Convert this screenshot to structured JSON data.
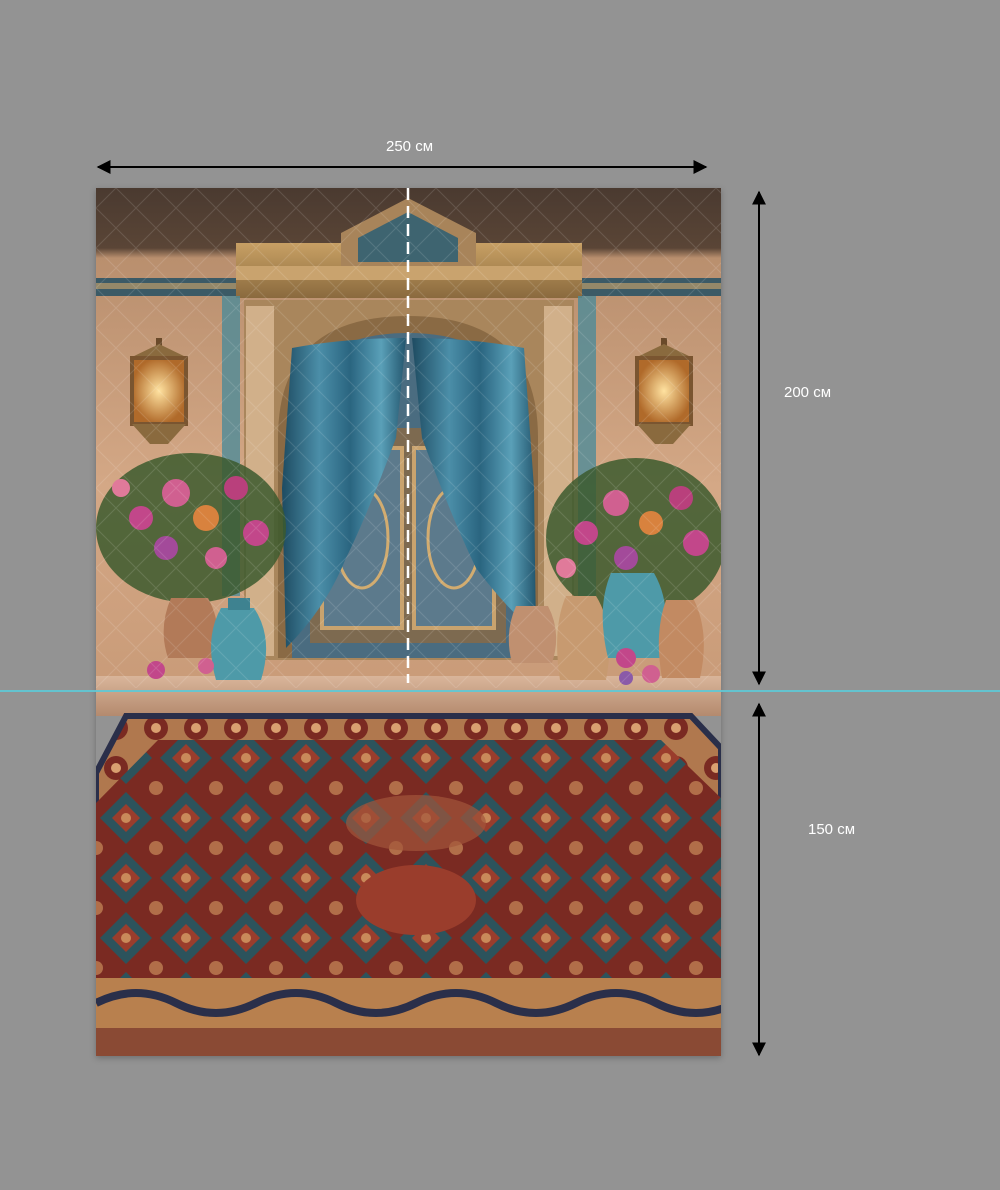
{
  "dimensions": {
    "width_label": "250 см",
    "height_top_label": "200 см",
    "height_bottom_label": "150 см"
  },
  "colors": {
    "canvas_bg": "#939393",
    "guide_line": "#5ec9d6",
    "arrow": "#000000",
    "label_text": "#ffffff",
    "curtain": "#3f7f99",
    "rug_red": "#7a2a22",
    "rug_teal": "#1f5a66",
    "wall": "#c79a78"
  }
}
